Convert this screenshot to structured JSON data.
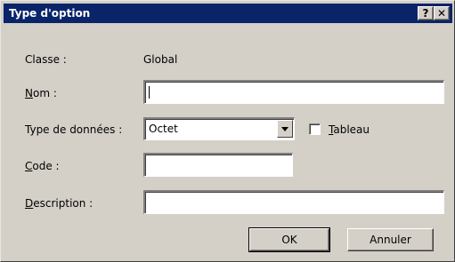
{
  "window": {
    "title": "Type d'option",
    "help_glyph": "?",
    "close_glyph": "✕"
  },
  "fields": {
    "classe_label": "Classe :",
    "classe_value": "Global",
    "nom_label_mn": "N",
    "nom_label_rest": "om :",
    "nom_value": "",
    "type_label": "Type de données :",
    "type_value": "Octet",
    "tableau_mn": "T",
    "tableau_rest": "ableau",
    "tableau_checked": false,
    "code_label_mn": "C",
    "code_label_rest": "ode :",
    "code_value": "",
    "description_label_mn": "D",
    "description_label_rest": "escription :",
    "description_value": ""
  },
  "buttons": {
    "ok": "OK",
    "cancel": "Annuler"
  }
}
